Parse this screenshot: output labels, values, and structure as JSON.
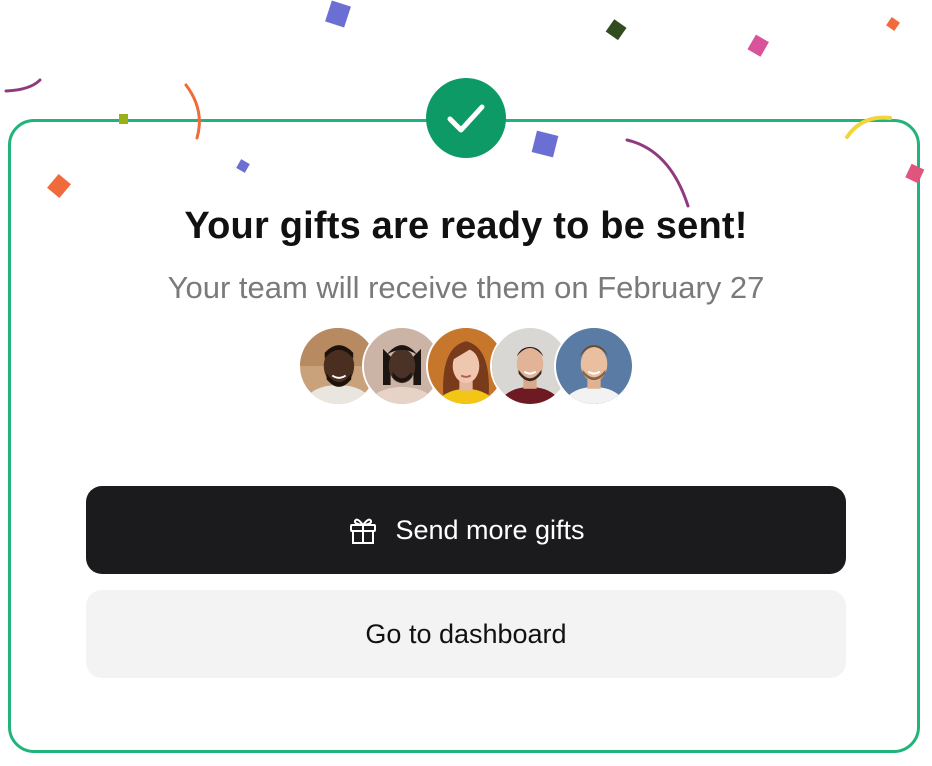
{
  "modal": {
    "title": "Your gifts are ready to be sent!",
    "subtitle": "Your team will receive them on February 27",
    "success_icon": "check-icon",
    "accent_color": "#22b37a",
    "badge_color": "#0e9a66"
  },
  "recipients": [
    {
      "icon": "avatar-photo"
    },
    {
      "icon": "avatar-photo"
    },
    {
      "icon": "avatar-photo"
    },
    {
      "icon": "avatar-photo"
    },
    {
      "icon": "avatar-photo"
    }
  ],
  "actions": {
    "primary_label": "Send more gifts",
    "primary_icon": "gift-icon",
    "primary_color": "#1b1b1d",
    "secondary_label": "Go to dashboard",
    "secondary_color": "#f3f3f3"
  },
  "decorations": {
    "confetti_colors": [
      "#6b6fd4",
      "#f06a3b",
      "#d9539b",
      "#e0547d",
      "#314d1f",
      "#8f3a7d",
      "#f2d53c",
      "#9bb017"
    ]
  }
}
